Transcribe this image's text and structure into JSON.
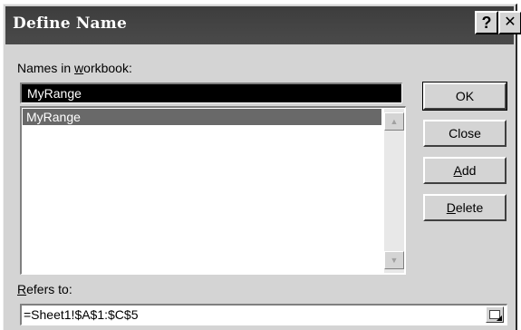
{
  "dialog": {
    "title": "Define Name",
    "help_glyph": "?",
    "close_glyph": "✕"
  },
  "names": {
    "label_pre": "Names in ",
    "label_accel": "w",
    "label_post": "orkbook:",
    "input_value": "MyRange",
    "items": [
      {
        "label": "MyRange",
        "selected": true
      }
    ]
  },
  "buttons": {
    "ok": "OK",
    "close": "Close",
    "add_accel": "A",
    "add_rest": "dd",
    "delete_accel": "D",
    "delete_rest": "elete"
  },
  "refers": {
    "label_accel": "R",
    "label_rest": "efers to:",
    "value": "=Sheet1!$A$1:$C$5"
  },
  "icons": {
    "scroll_up": "scroll-up-arrow-icon",
    "scroll_down": "scroll-down-arrow-icon",
    "collapse": "collapse-dialog-icon"
  }
}
